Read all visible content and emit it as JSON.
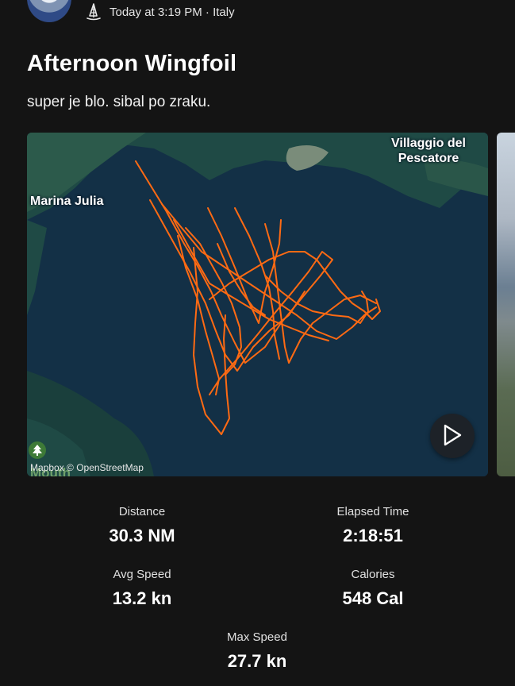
{
  "header": {
    "timestamp": "Today at 3:19 PM",
    "location": "Italy",
    "separator": " · ",
    "sport_icon": "windsurf-icon"
  },
  "activity": {
    "title": "Afternoon Wingfoil",
    "description": "super je blo. sibal po zraku."
  },
  "map": {
    "labels": {
      "marina": "Marina Julia",
      "villaggio": "Villaggio del Pescatore",
      "mouth": "Mouth"
    },
    "attribution": "Mapbox © OpenStreetMap",
    "track_color": "#ff6a13",
    "water_color": "#133046",
    "land_color": "#1f4a45",
    "play_icon": "play-icon",
    "tree_icon": "tree-icon"
  },
  "stats": {
    "distance": {
      "label": "Distance",
      "value": "30.3 NM"
    },
    "elapsed": {
      "label": "Elapsed Time",
      "value": "2:18:51"
    },
    "avg_speed": {
      "label": "Avg Speed",
      "value": "13.2 kn"
    },
    "calories": {
      "label": "Calories",
      "value": "548 Cal"
    },
    "max_speed": {
      "label": "Max Speed",
      "value": "27.7 kn"
    }
  }
}
